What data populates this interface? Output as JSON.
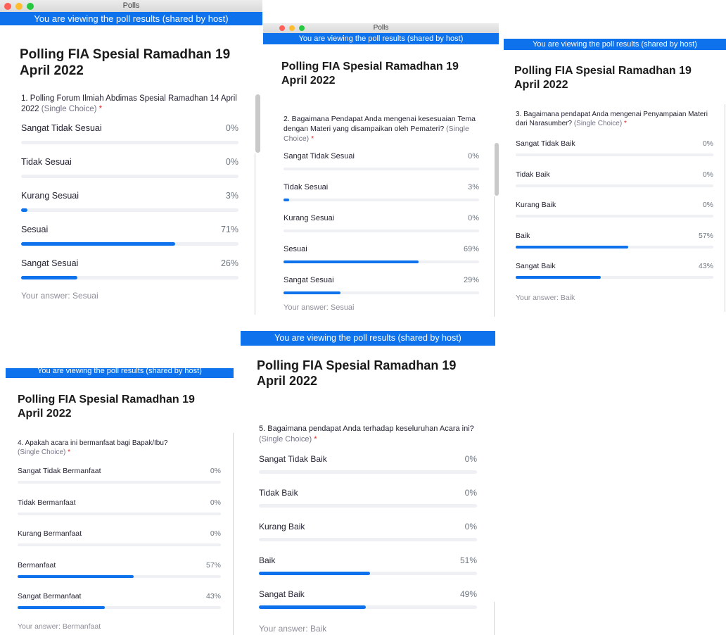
{
  "window_title": "Polls",
  "banner_text": "You are viewing the poll results (shared by host)",
  "poll_title": "Polling FIA Spesial Ramadhan 19 April 2022",
  "answer_prefix": "Your answer: ",
  "single_choice": "(Single Choice)",
  "required_mark": "*",
  "colors": {
    "accent": "#0e72ed",
    "track": "#eef0f3",
    "required": "#e02828"
  },
  "icons": [
    "close-light-icon",
    "minimize-light-icon",
    "zoom-light-icon"
  ],
  "questions": [
    {
      "text": "1. Polling Forum Ilmiah Abdimas Spesial Ramadhan 14 April 2022",
      "answer": "Sesuai",
      "options": [
        {
          "label": "Sangat Tidak Sesuai",
          "percent": "0%",
          "value": 0
        },
        {
          "label": "Tidak Sesuai",
          "percent": "0%",
          "value": 0
        },
        {
          "label": "Kurang Sesuai",
          "percent": "3%",
          "value": 3
        },
        {
          "label": "Sesuai",
          "percent": "71%",
          "value": 71
        },
        {
          "label": "Sangat Sesuai",
          "percent": "26%",
          "value": 26
        }
      ]
    },
    {
      "text": "2. Bagaimana Pendapat Anda mengenai kesesuaian Tema dengan Materi yang disampaikan oleh Pemateri?",
      "answer": "Sesuai",
      "options": [
        {
          "label": "Sangat Tidak Sesuai",
          "percent": "0%",
          "value": 0
        },
        {
          "label": "Tidak Sesuai",
          "percent": "3%",
          "value": 3
        },
        {
          "label": "Kurang Sesuai",
          "percent": "0%",
          "value": 0
        },
        {
          "label": "Sesuai",
          "percent": "69%",
          "value": 69
        },
        {
          "label": "Sangat Sesuai",
          "percent": "29%",
          "value": 29
        }
      ]
    },
    {
      "text": "3. Bagaimana pendapat Anda mengenai Penyampaian Materi dari Narasumber?",
      "answer": "Baik",
      "options": [
        {
          "label": "Sangat Tidak Baik",
          "percent": "0%",
          "value": 0
        },
        {
          "label": "Tidak Baik",
          "percent": "0%",
          "value": 0
        },
        {
          "label": "Kurang Baik",
          "percent": "0%",
          "value": 0
        },
        {
          "label": "Baik",
          "percent": "57%",
          "value": 57
        },
        {
          "label": "Sangat Baik",
          "percent": "43%",
          "value": 43
        }
      ]
    },
    {
      "text": "4. Apakah acara ini bermanfaat bagi Bapak/Ibu?",
      "answer": "Bermanfaat",
      "options": [
        {
          "label": "Sangat Tidak Bermanfaat",
          "percent": "0%",
          "value": 0
        },
        {
          "label": "Tidak Bermanfaat",
          "percent": "0%",
          "value": 0
        },
        {
          "label": "Kurang Bermanfaat",
          "percent": "0%",
          "value": 0
        },
        {
          "label": "Bermanfaat",
          "percent": "57%",
          "value": 57
        },
        {
          "label": "Sangat Bermanfaat",
          "percent": "43%",
          "value": 43
        }
      ]
    },
    {
      "text": "5. Bagaimana pendapat Anda terhadap keseluruhan Acara ini?",
      "answer": "Baik",
      "options": [
        {
          "label": "Sangat Tidak Baik",
          "percent": "0%",
          "value": 0
        },
        {
          "label": "Tidak Baik",
          "percent": "0%",
          "value": 0
        },
        {
          "label": "Kurang Baik",
          "percent": "0%",
          "value": 0
        },
        {
          "label": "Baik",
          "percent": "51%",
          "value": 51
        },
        {
          "label": "Sangat Baik",
          "percent": "49%",
          "value": 49
        }
      ]
    }
  ]
}
